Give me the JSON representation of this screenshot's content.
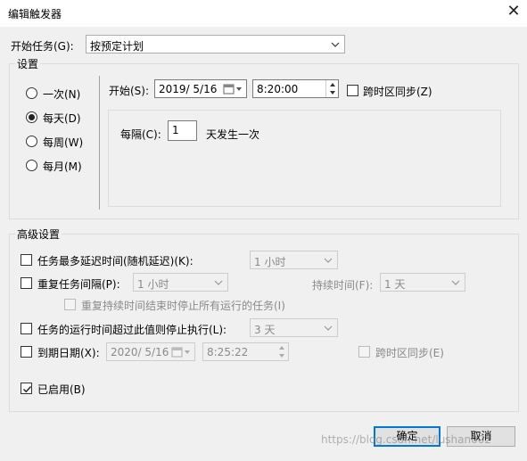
{
  "window": {
    "title": "编辑触发器",
    "close_glyph": "✕"
  },
  "begin_task": {
    "label": "开始任务(G):",
    "value": "按预定计划"
  },
  "settings": {
    "legend": "设置",
    "radios": [
      {
        "label": "一次(N)",
        "checked": false
      },
      {
        "label": "每天(D)",
        "checked": true
      },
      {
        "label": "每周(W)",
        "checked": false
      },
      {
        "label": "每月(M)",
        "checked": false
      }
    ],
    "start_label": "开始(S):",
    "start_date": "2019/  5/16",
    "start_time": "8:20:00",
    "sync_tz_label": "跨时区同步(Z)",
    "every_label": "每隔(C):",
    "every_value": "1",
    "every_suffix": "天发生一次"
  },
  "advanced": {
    "legend": "高级设置",
    "delay_label": "任务最多延迟时间(随机延迟)(K):",
    "delay_value": "1 小时",
    "repeat_label": "重复任务间隔(P):",
    "repeat_value": "1 小时",
    "duration_label": "持续时间(F):",
    "duration_value": "1 天",
    "stop_all_label": "重复持续时间结束时停止所有运行的任务(I)",
    "stop_longer_label": "任务的运行时间超过此值则停止执行(L):",
    "stop_longer_value": "3 天",
    "expire_label": "到期日期(X):",
    "expire_date": "2020/  5/16",
    "expire_time": "8:25:22",
    "expire_sync_label": "跨时区同步(E)",
    "enabled_label": "已启用(B)"
  },
  "buttons": {
    "ok": "确定",
    "cancel": "取消"
  },
  "watermark": "https://blog.csdn.net/lushan002",
  "colors": {
    "accent": "#0078d7",
    "dialog_bg": "#f0f0f0",
    "disabled_text": "#8a8a8a"
  }
}
